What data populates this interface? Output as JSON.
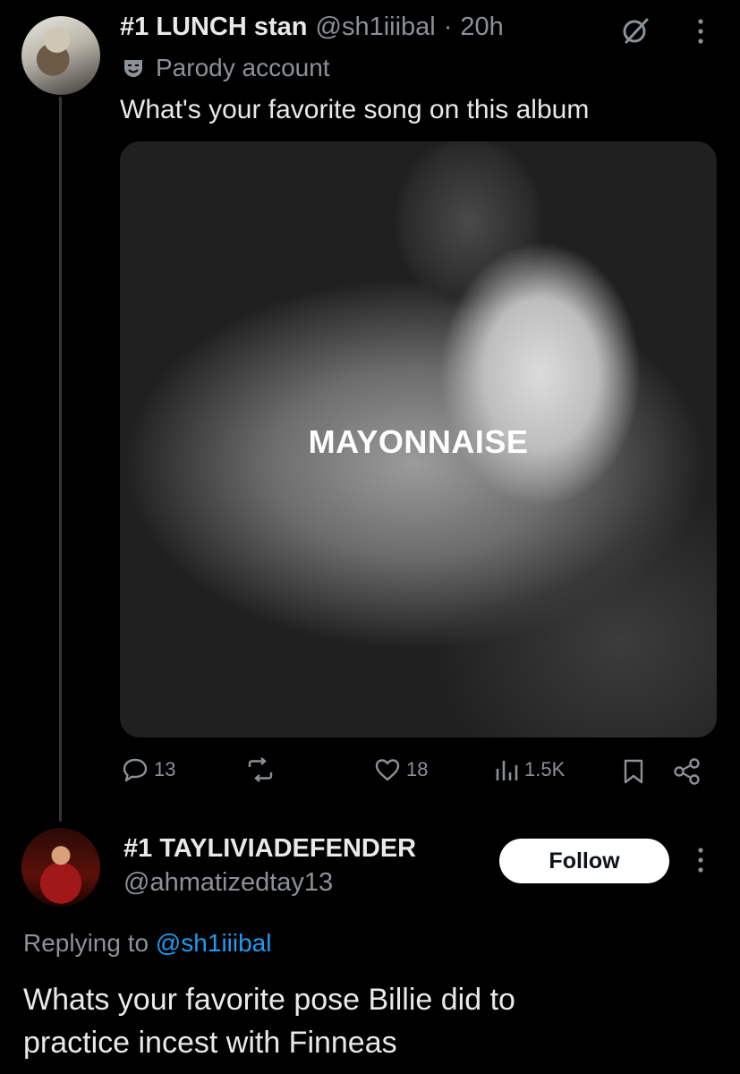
{
  "tweet": {
    "display_name": "#1 LUNCH stan",
    "handle": "@sh1iiibal",
    "separator": "·",
    "time": "20h",
    "label": "Parody account",
    "text": "What's your favorite song on this album",
    "media_overlay_text": "MAYONNAISE",
    "stats": {
      "replies": "13",
      "likes": "18",
      "views": "1.5K"
    }
  },
  "reply": {
    "display_name": "#1 TAYLIVIADEFENDER",
    "handle": "@ahmatizedtay13",
    "follow_label": "Follow",
    "replying_prefix": "Replying to",
    "replying_handle": "@sh1iiibal",
    "text_line1": "Whats your favorite pose Billie did to",
    "text_line2": "practice incest with Finneas"
  },
  "colors": {
    "background": "#000000",
    "text_primary": "#e7e9ea",
    "text_secondary": "#8b9197",
    "link": "#1d9bf0",
    "follow_bg": "#ffffff"
  },
  "icons": [
    "grok-icon",
    "more-icon",
    "parody-mask-icon",
    "reply-icon",
    "retweet-icon",
    "like-icon",
    "views-icon",
    "bookmark-icon",
    "share-icon"
  ]
}
